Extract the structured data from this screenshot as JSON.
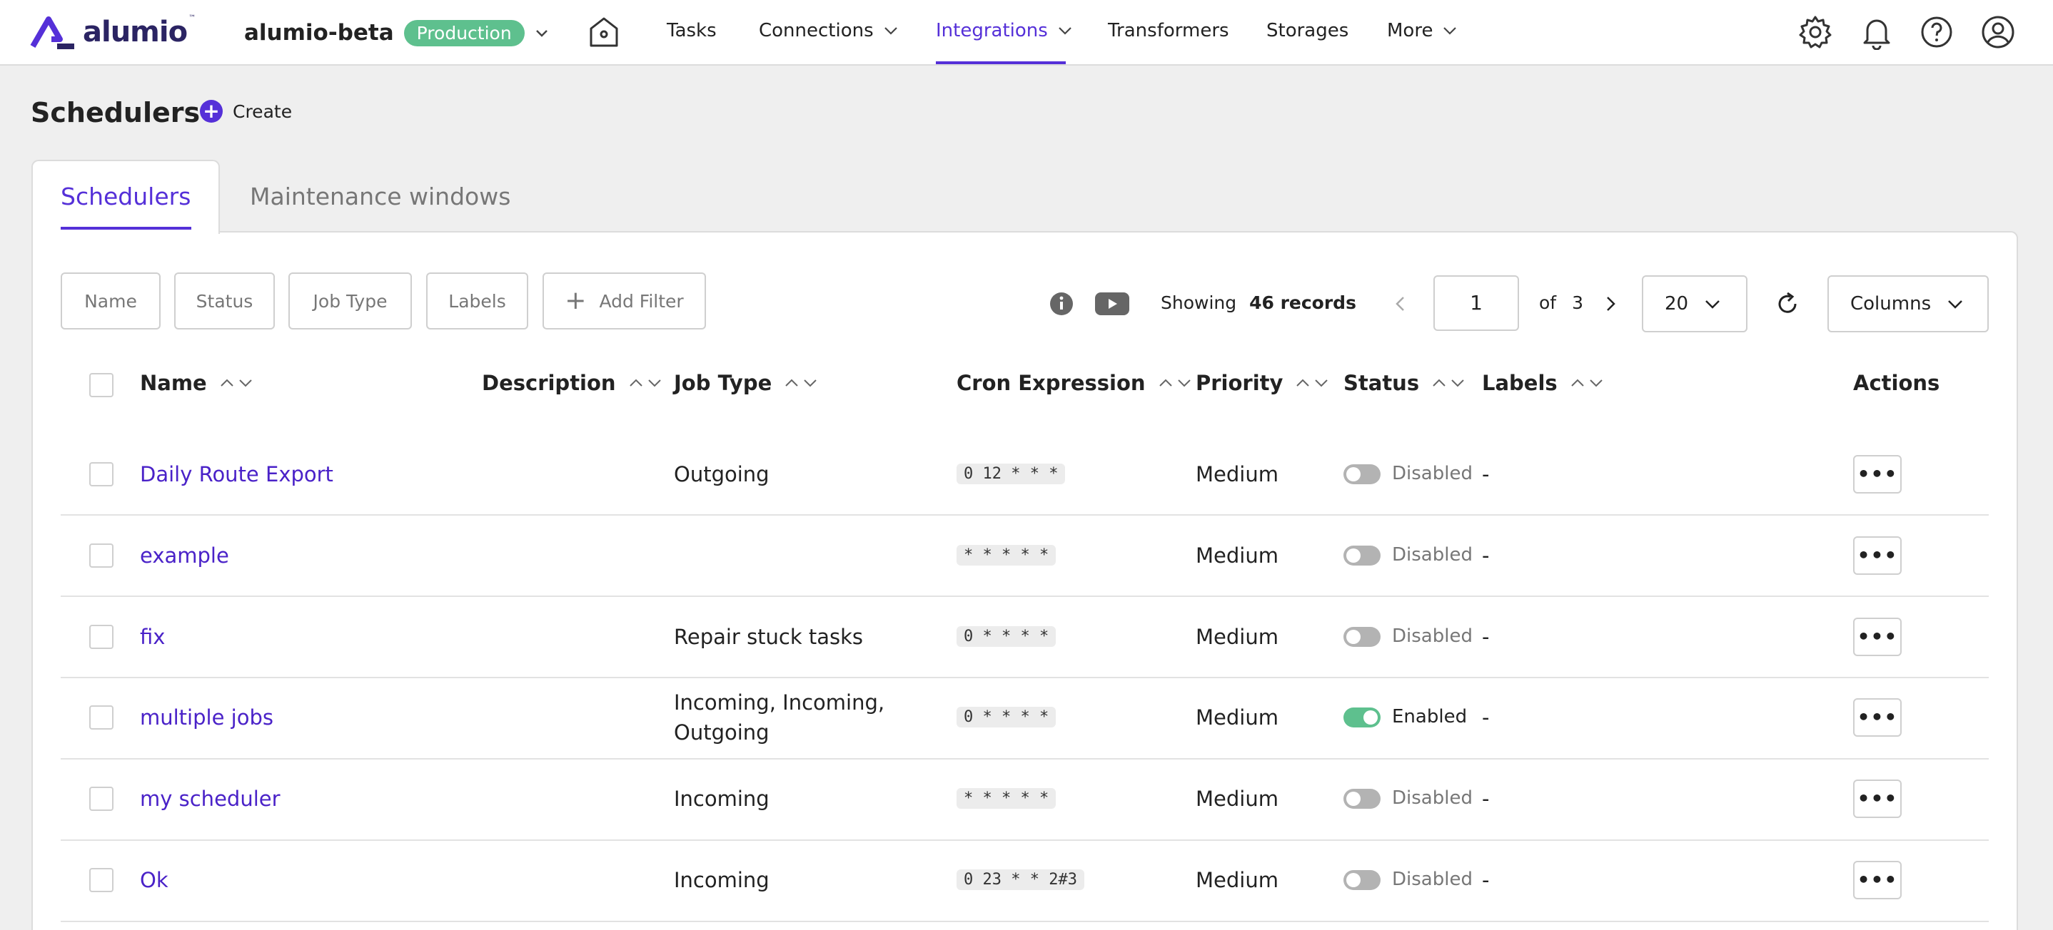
{
  "brand": {
    "logo_text": "alumio",
    "logo_mark": "™"
  },
  "env": {
    "name": "alumio-beta",
    "badge": "Production"
  },
  "nav": {
    "tasks": "Tasks",
    "connections": "Connections",
    "integrations": "Integrations",
    "transformers": "Transformers",
    "storages": "Storages",
    "more": "More"
  },
  "page": {
    "title": "Schedulers",
    "create_label": "Create"
  },
  "tabs": {
    "schedulers": "Schedulers",
    "maintenance": "Maintenance windows"
  },
  "filters": {
    "name": "Name",
    "status": "Status",
    "job_type": "Job Type",
    "labels": "Labels",
    "add_filter": "Add Filter"
  },
  "toolbar": {
    "showing_label": "Showing",
    "records": "46 records",
    "page_value": "1",
    "of_label": "of",
    "total_pages": "3",
    "per_page": "20",
    "columns_label": "Columns"
  },
  "table": {
    "headers": {
      "name": "Name",
      "description": "Description",
      "job_type": "Job Type",
      "cron": "Cron Expression",
      "priority": "Priority",
      "status": "Status",
      "labels": "Labels",
      "actions": "Actions"
    },
    "rows": [
      {
        "name": "Daily Route Export",
        "description": "",
        "job_type": "Outgoing",
        "job_type_line2": "",
        "cron": "0 12 * * *",
        "priority": "Medium",
        "status": "Disabled",
        "enabled": false,
        "labels": "-",
        "action": "•••"
      },
      {
        "name": "example",
        "description": "",
        "job_type": "",
        "job_type_line2": "",
        "cron": "* * * * *",
        "priority": "Medium",
        "status": "Disabled",
        "enabled": false,
        "labels": "-",
        "action": "•••"
      },
      {
        "name": "fix",
        "description": "",
        "job_type": "Repair stuck tasks",
        "job_type_line2": "",
        "cron": "0 * * * *",
        "priority": "Medium",
        "status": "Disabled",
        "enabled": false,
        "labels": "-",
        "action": "•••"
      },
      {
        "name": "multiple jobs",
        "description": "",
        "job_type": "Incoming, Incoming,",
        "job_type_line2": "Outgoing",
        "cron": "0 * * * *",
        "priority": "Medium",
        "status": "Enabled",
        "enabled": true,
        "labels": "-",
        "action": "•••"
      },
      {
        "name": "my scheduler",
        "description": "",
        "job_type": "Incoming",
        "job_type_line2": "",
        "cron": "* * * * *",
        "priority": "Medium",
        "status": "Disabled",
        "enabled": false,
        "labels": "-",
        "action": "•••"
      },
      {
        "name": "Ok",
        "description": "",
        "job_type": "Incoming",
        "job_type_line2": "",
        "cron": "0 23 * * 2#3",
        "priority": "Medium",
        "status": "Disabled",
        "enabled": false,
        "labels": "-",
        "action": "•••"
      }
    ]
  },
  "colors": {
    "accent": "#5530d8",
    "badge": "#5ec08e",
    "toggle_on": "#5ec08e",
    "toggle_off": "#b3b3b3"
  }
}
